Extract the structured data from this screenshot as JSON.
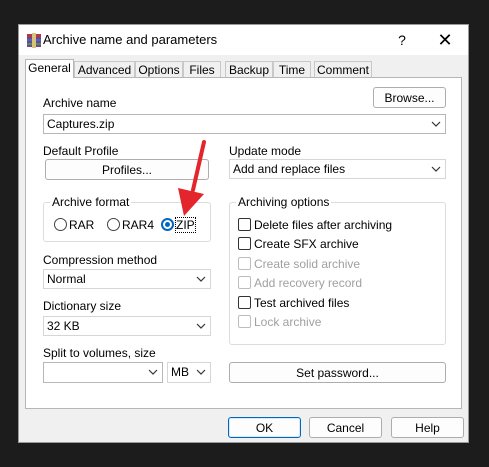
{
  "window": {
    "title": "Archive name and parameters",
    "help_glyph": "?",
    "close_glyph": "✕"
  },
  "tabs": [
    "General",
    "Advanced",
    "Options",
    "Files",
    "Backup",
    "Time",
    "Comment"
  ],
  "general": {
    "archive_name_label": "Archive name",
    "browse_label": "Browse...",
    "archive_name_value": "Captures.zip",
    "default_profile_label": "Default Profile",
    "profiles_label": "Profiles...",
    "update_mode_label": "Update mode",
    "update_mode_value": "Add and replace files",
    "archive_format_label": "Archive format",
    "formats": [
      "RAR",
      "RAR4",
      "ZIP"
    ],
    "selected_format": "ZIP",
    "archiving_options_label": "Archiving options",
    "options": [
      {
        "label": "Delete files after archiving",
        "checked": false,
        "enabled": true
      },
      {
        "label": "Create SFX archive",
        "checked": false,
        "enabled": true
      },
      {
        "label": "Create solid archive",
        "checked": false,
        "enabled": false
      },
      {
        "label": "Add recovery record",
        "checked": false,
        "enabled": false
      },
      {
        "label": "Test archived files",
        "checked": false,
        "enabled": true
      },
      {
        "label": "Lock archive",
        "checked": false,
        "enabled": false
      }
    ],
    "compression_method_label": "Compression method",
    "compression_method_value": "Normal",
    "dictionary_size_label": "Dictionary size",
    "dictionary_size_value": "32 KB",
    "split_label": "Split to volumes, size",
    "split_value": "",
    "split_unit": "MB",
    "set_password_label": "Set password..."
  },
  "footer": {
    "ok_label": "OK",
    "cancel_label": "Cancel",
    "help_label": "Help"
  },
  "colors": {
    "accent": "#0067c0",
    "annotation_arrow": "#e3262b"
  }
}
